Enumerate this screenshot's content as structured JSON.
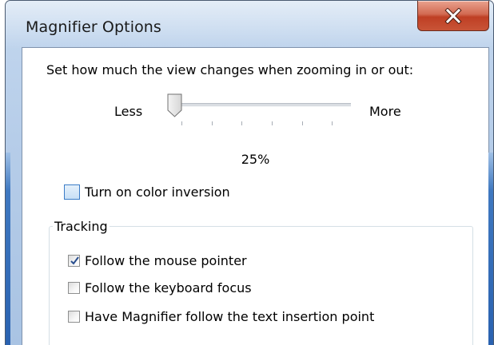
{
  "window": {
    "title": "Magnifier Options",
    "close_icon": "close-icon"
  },
  "zoom": {
    "description": "Set how much the view changes when zooming in or out:",
    "less_label": "Less",
    "more_label": "More",
    "value_label": "25%",
    "slider_value_fraction": 0.0
  },
  "color_inversion": {
    "label": "Turn on color inversion",
    "checked": false
  },
  "tracking": {
    "group_title": "Tracking",
    "items": [
      {
        "label": "Follow the mouse pointer",
        "checked": true
      },
      {
        "label": "Follow the keyboard focus",
        "checked": false
      },
      {
        "label": "Have Magnifier follow the text insertion point",
        "checked": false
      }
    ]
  },
  "colors": {
    "close_button": "#c85437",
    "checkmark": "#2a4f8f",
    "accent_blue": "#3b7cc7"
  }
}
